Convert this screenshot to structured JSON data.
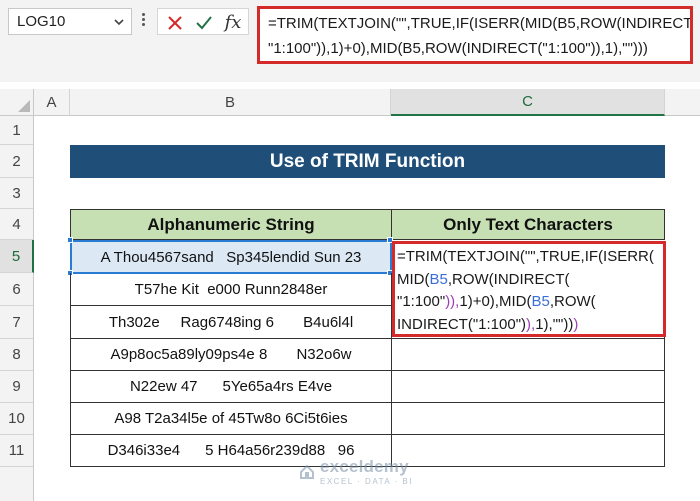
{
  "name_box": {
    "value": "LOG10"
  },
  "formula_bar": {
    "line1": "=TRIM(TEXTJOIN(\"\",TRUE,IF(ISERR(MID(B5,ROW(INDIRECT(",
    "line2": "\"1:100\")),1)+0),MID(B5,ROW(INDIRECT(\"1:100\")),1),\"\")))",
    "fx_label": "fx"
  },
  "columns": [
    {
      "label": "A"
    },
    {
      "label": "B"
    },
    {
      "label": "C"
    }
  ],
  "rows": [
    "1",
    "2",
    "3",
    "4",
    "5",
    "6",
    "7",
    "8",
    "9",
    "10",
    "11"
  ],
  "sheet": {
    "title": "Use of TRIM Function",
    "headers": {
      "col_b": "Alphanumeric String",
      "col_c": "Only Text Characters"
    },
    "data": [
      "A Thou4567sand   Sp345lendid Sun 23",
      "T57he Kit  e000 Runn2848er",
      "Th302e     Rag6748ing 6       B4u6l4l",
      "A9p8oc5a89ly09ps4e 8       N32o6w",
      "N22ew 47      5Ye65a4rs E4ve",
      "A98 T2a34l5e of 45Tw8o 6Ci5t6ies",
      "D346i33e4      5 H64a56r239d88   96"
    ],
    "active_cell": "C5",
    "selected_source_cell": "B5"
  },
  "in_cell_edit": {
    "lines": [
      [
        {
          "t": "=TRIM(TEXTJOIN(\"\",TRUE,IF(ISERR(",
          "c": "n"
        }
      ],
      [
        {
          "t": "MID(",
          "c": "n"
        },
        {
          "t": "B5",
          "c": "b"
        },
        {
          "t": ",ROW(INDIRECT(",
          "c": "n"
        }
      ],
      [
        {
          "t": "\"1:100\"",
          "c": "n"
        },
        {
          "t": ")),",
          "c": "r"
        },
        {
          "t": "1)+0),MID(",
          "c": "n"
        },
        {
          "t": "B5",
          "c": "b"
        },
        {
          "t": ",ROW(",
          "c": "n"
        }
      ],
      [
        {
          "t": "INDIRECT(\"1:100\")",
          "c": "n"
        },
        {
          "t": "),",
          "c": "r"
        },
        {
          "t": "1),\"\"))",
          "c": "n"
        },
        {
          "t": ")",
          "c": "r"
        }
      ]
    ]
  },
  "watermark": {
    "name": "exceldemy",
    "tagline": "EXCEL · DATA · BI"
  },
  "colors": {
    "title_bg": "#1f4e79",
    "header_bg": "#c6e0b4",
    "highlight_red": "#d42a2a",
    "selection_blue": "#2a7bd4",
    "excel_green": "#217346"
  },
  "icons": [
    "chevron-down-icon",
    "cancel-icon",
    "enter-icon",
    "insert-function-icon"
  ]
}
